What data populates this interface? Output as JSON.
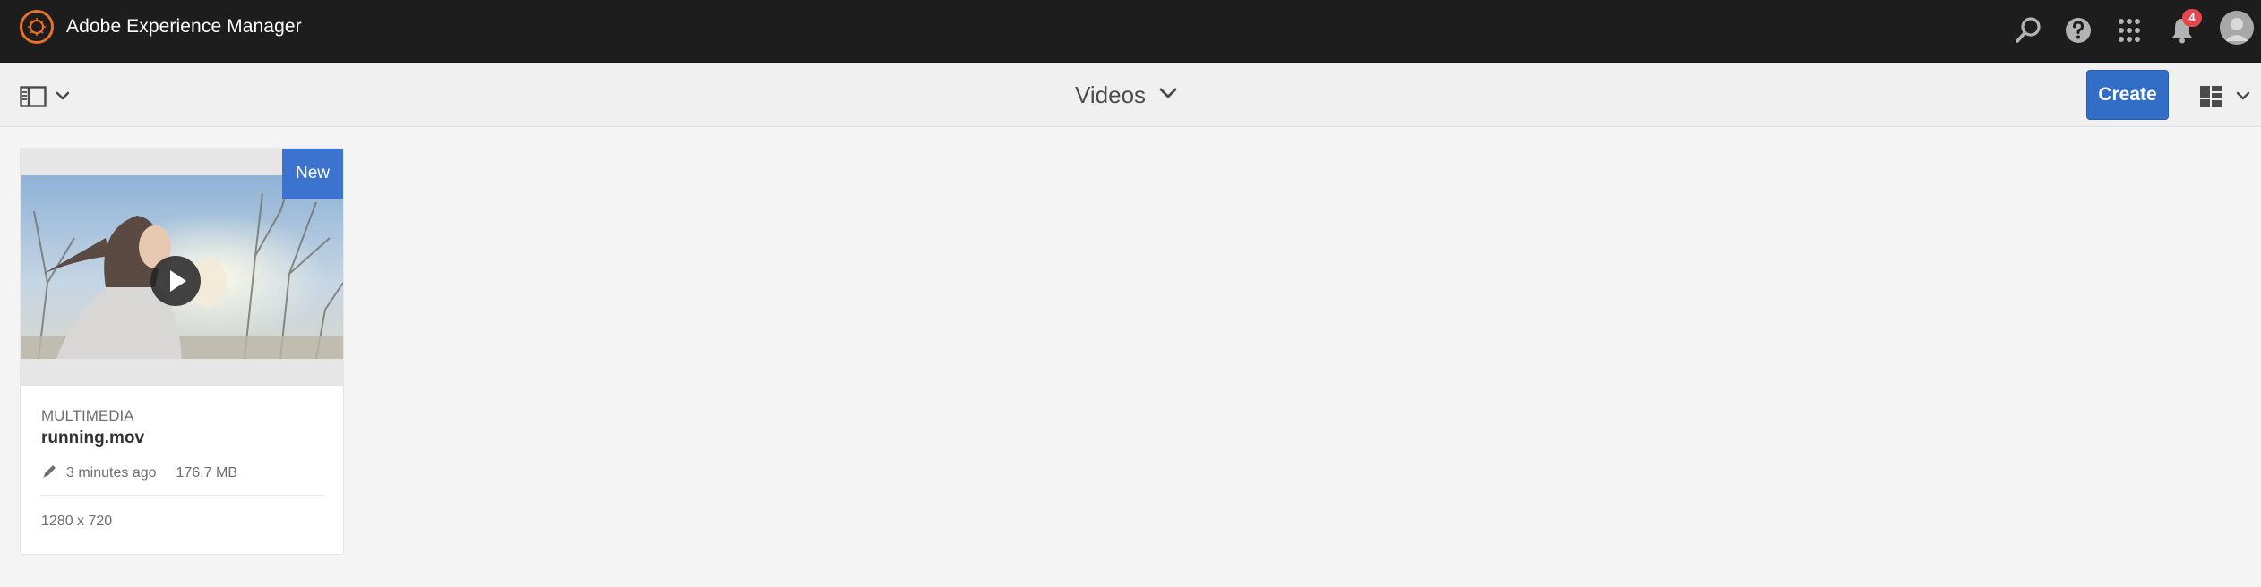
{
  "header": {
    "app_title": "Adobe Experience Manager",
    "notification_count": "4",
    "icons": [
      "adobe-logo-icon",
      "search-icon",
      "help-icon",
      "apps-grid-icon",
      "bell-icon",
      "user-avatar"
    ]
  },
  "actionbar": {
    "page_title": "Videos",
    "create_label": "Create",
    "view_mode": "card-view"
  },
  "assets": [
    {
      "badge": "New",
      "type": "MULTIMEDIA",
      "title": "running.mov",
      "modified": "3 minutes ago",
      "size": "176.7 MB",
      "dimensions": "1280 x 720"
    }
  ],
  "colors": {
    "topbar": "#1d1d1d",
    "accent": "#326ec8",
    "logo_ring": "#e8702a",
    "badge": "#e34850"
  }
}
